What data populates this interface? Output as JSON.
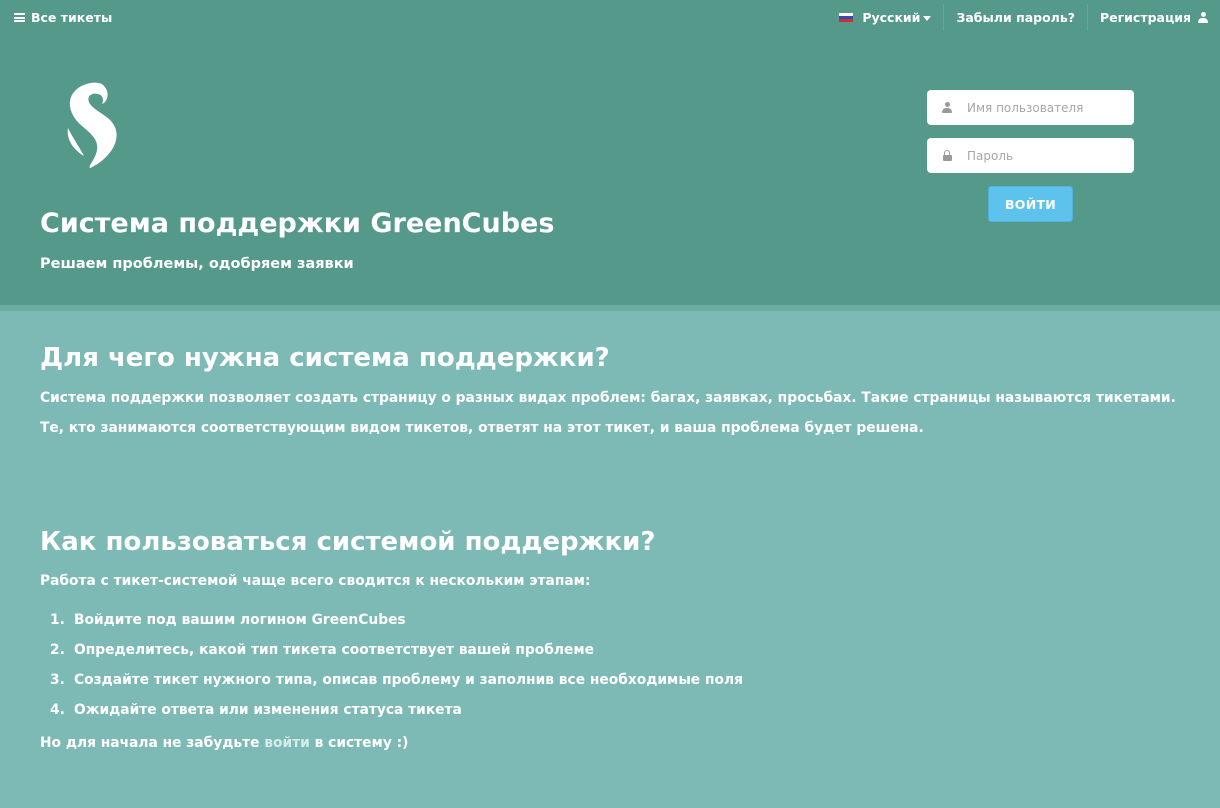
{
  "topbar": {
    "all_tickets": "Все тикеты",
    "language": "Русский",
    "forgot_password": "Забыли пароль?",
    "register": "Регистрация"
  },
  "hero": {
    "title": "Система поддержки GreenCubes",
    "subtitle": "Решаем проблемы, одобряем заявки"
  },
  "login": {
    "username_placeholder": "Имя пользователя",
    "password_placeholder": "Пароль",
    "submit_label": "ВОЙТИ"
  },
  "section1": {
    "heading": "Для чего нужна система поддержки?",
    "line1": "Система поддержки позволяет создать страницу о разных видах проблем: багах, заявках, просьбах. Такие страницы называются тикетами.",
    "line2": "Те, кто занимаются соответствующим видом тикетов, ответят на этот тикет, и ваша проблема будет решена."
  },
  "section2": {
    "heading": "Как пользоваться системой поддержки?",
    "intro": "Работа с тикет-системой чаще всего сводится к нескольким этапам:",
    "steps": [
      {
        "num": "1.",
        "text": "Войдите под вашим логином GreenCubes"
      },
      {
        "num": "2.",
        "text": "Определитесь, какой тип тикета соответствует вашей проблеме"
      },
      {
        "num": "3.",
        "text": "Создайте тикет нужного типа, описав проблему и заполнив все необходимые поля"
      },
      {
        "num": "4.",
        "text": "Ожидайте ответа или изменения статуса тикета"
      }
    ],
    "outro_before": "Но для начала не забудьте",
    "outro_link": "войти",
    "outro_after": "в систему :)"
  },
  "colors": {
    "header_bg": "#55998a",
    "content_bg": "#7dbab5",
    "button_bg": "#5ec3ec"
  },
  "icons": {
    "menu": "menu-icon",
    "flag": "russia-flag-icon",
    "user": "user-icon",
    "lock": "lock-icon",
    "logo": "greencubes-logo"
  }
}
